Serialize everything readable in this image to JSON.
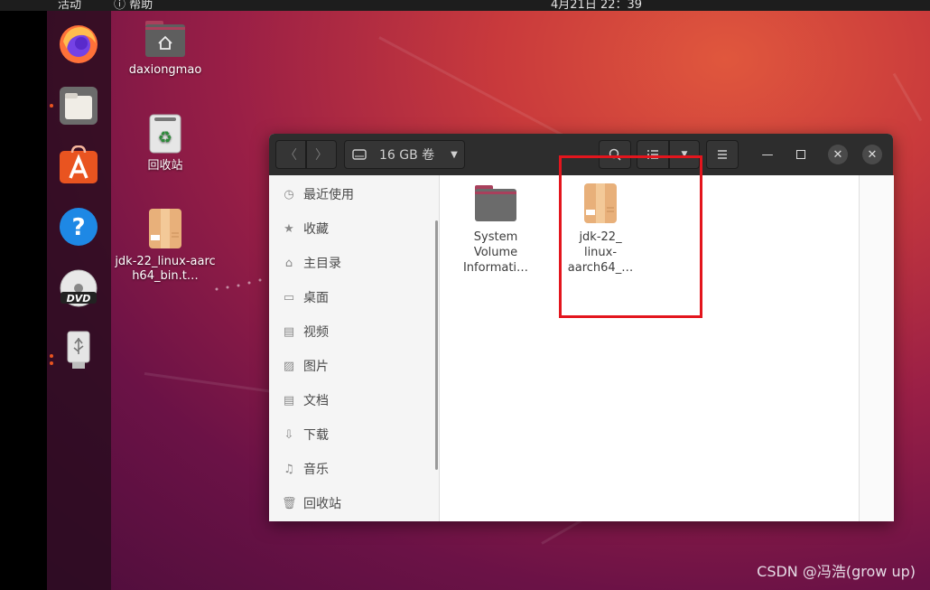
{
  "topbar": {
    "activities": "活动",
    "help": "帮助",
    "clock": "4月21日 22：39"
  },
  "dock": {
    "items": [
      {
        "name": "firefox",
        "icon": "firefox-icon"
      },
      {
        "name": "files",
        "icon": "folder-icon",
        "running": true
      },
      {
        "name": "software",
        "icon": "software-center-icon"
      },
      {
        "name": "help",
        "icon": "help-icon"
      },
      {
        "name": "dvd",
        "icon": "dvd-icon",
        "label": "DVD"
      },
      {
        "name": "usb",
        "icon": "usb-drive-icon",
        "running": true
      }
    ]
  },
  "desktop": {
    "home_label": "daxiongmao",
    "trash_label": "回收站",
    "jdk_label": "jdk-22_linux-aarch64_bin.t…"
  },
  "window": {
    "location": "16 GB 卷",
    "sidebar": [
      {
        "label": "最近使用",
        "icon": "clock-icon"
      },
      {
        "label": "收藏",
        "icon": "star-icon"
      },
      {
        "label": "主目录",
        "icon": "home-icon"
      },
      {
        "label": "桌面",
        "icon": "desktop-icon"
      },
      {
        "label": "视频",
        "icon": "video-icon"
      },
      {
        "label": "图片",
        "icon": "picture-icon"
      },
      {
        "label": "文档",
        "icon": "document-icon"
      },
      {
        "label": "下载",
        "icon": "download-icon"
      },
      {
        "label": "音乐",
        "icon": "music-icon"
      },
      {
        "label": "回收站",
        "icon": "trash-icon"
      }
    ],
    "files": [
      {
        "label": "System Volume Informati…",
        "icon": "folder-icon"
      },
      {
        "label": "jdk-22_ linux- aarch64_…",
        "icon": "archive-icon"
      }
    ]
  },
  "watermark": "CSDN @冯浩(grow up)",
  "colors": {
    "accent": "#e95420",
    "highlight_box": "#e3151d"
  }
}
